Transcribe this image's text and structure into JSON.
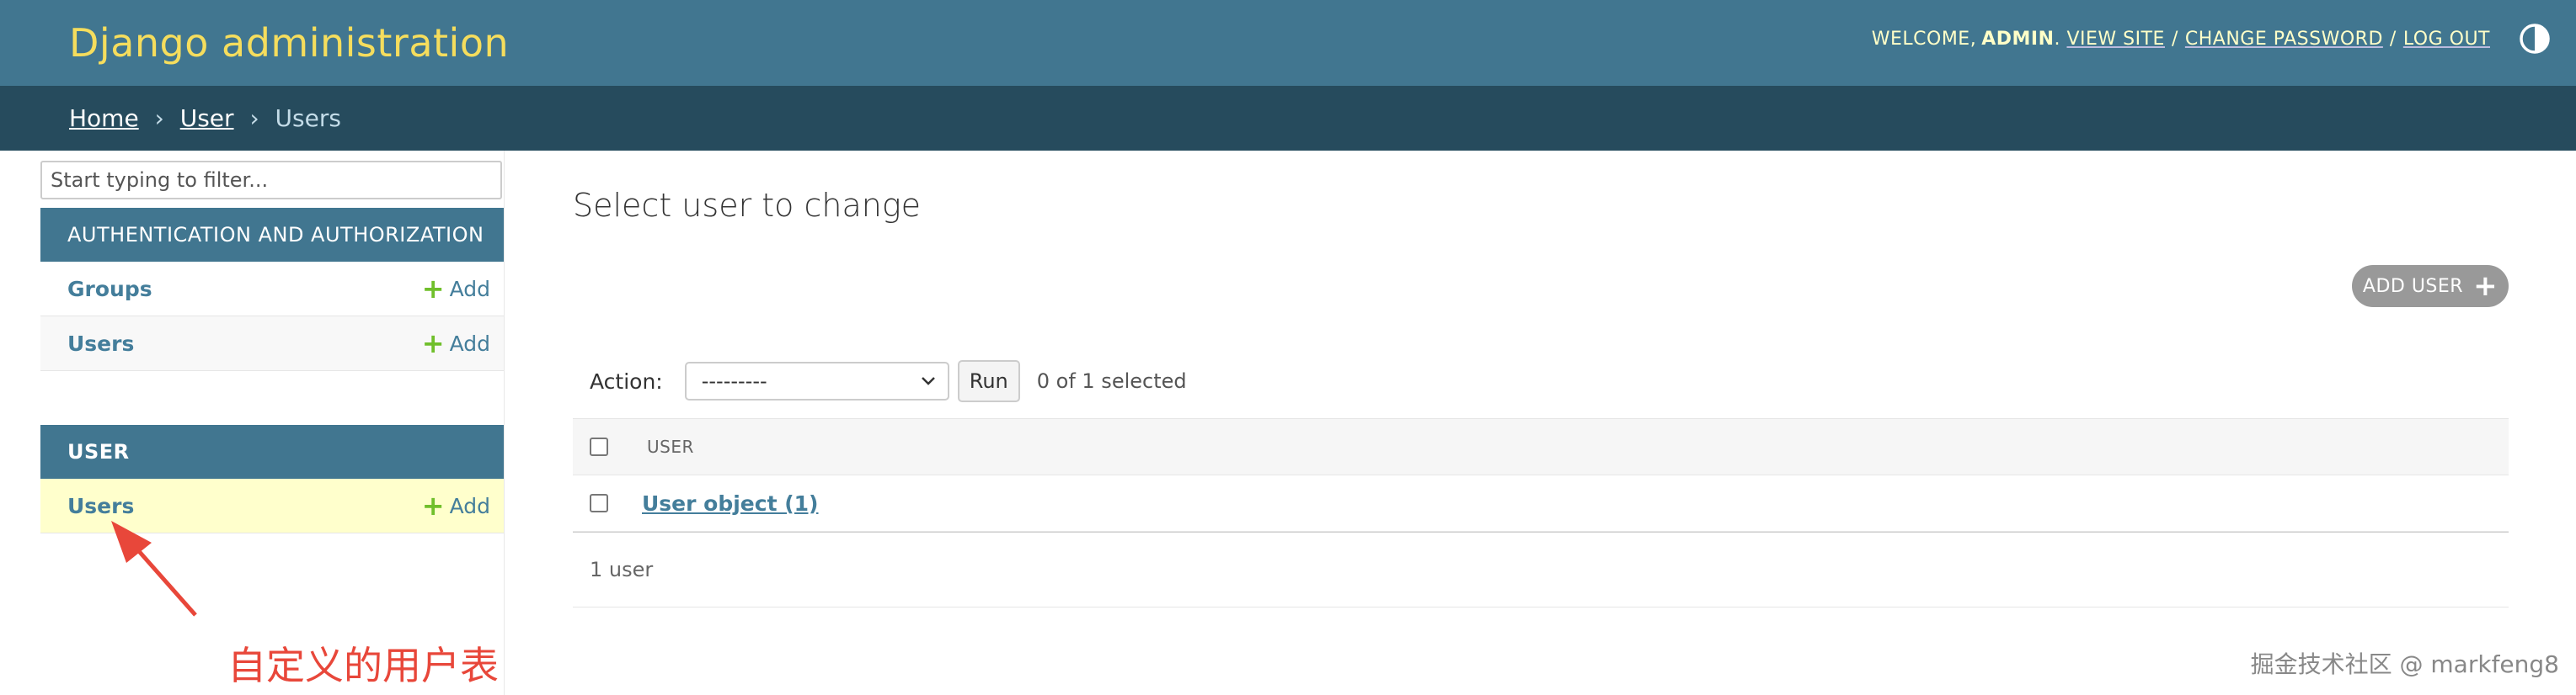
{
  "header": {
    "site_name": "Django administration",
    "welcome": "WELCOME,",
    "username": "ADMIN",
    "view_site": "VIEW SITE",
    "change_password": "CHANGE PASSWORD",
    "log_out": "LOG OUT",
    "separator": "/",
    "theme_icon": "theme-toggle-icon"
  },
  "breadcrumbs": {
    "home": "Home",
    "app": "User",
    "current": "Users",
    "separator": "›"
  },
  "sidebar": {
    "filter_placeholder": "Start typing to filter...",
    "modules": [
      {
        "caption": "AUTHENTICATION AND AUTHORIZATION",
        "models": [
          {
            "name": "Groups",
            "add": "Add"
          },
          {
            "name": "Users",
            "add": "Add"
          }
        ]
      },
      {
        "caption": "USER",
        "models": [
          {
            "name": "Users",
            "add": "Add"
          }
        ]
      }
    ]
  },
  "annotation": {
    "text": "自定义的用户表",
    "color": "#e8473a"
  },
  "main": {
    "title": "Select user to change",
    "add_button": "ADD USER",
    "action_label": "Action:",
    "action_selected": "---------",
    "run_button": "Run",
    "selection_counter": "0 of 1 selected",
    "column_header": "USER",
    "rows": [
      {
        "label": "User object (1)"
      }
    ],
    "paginator": "1 user"
  },
  "watermark": "掘金技术社区 @ markfeng8",
  "colors": {
    "header_bg": "#417690",
    "breadcrumb_bg": "#264b5d",
    "brand": "#f5dd5d",
    "link": "#447e9b",
    "add_plus": "#70bf2b",
    "selected_row": "#ffffcc"
  }
}
